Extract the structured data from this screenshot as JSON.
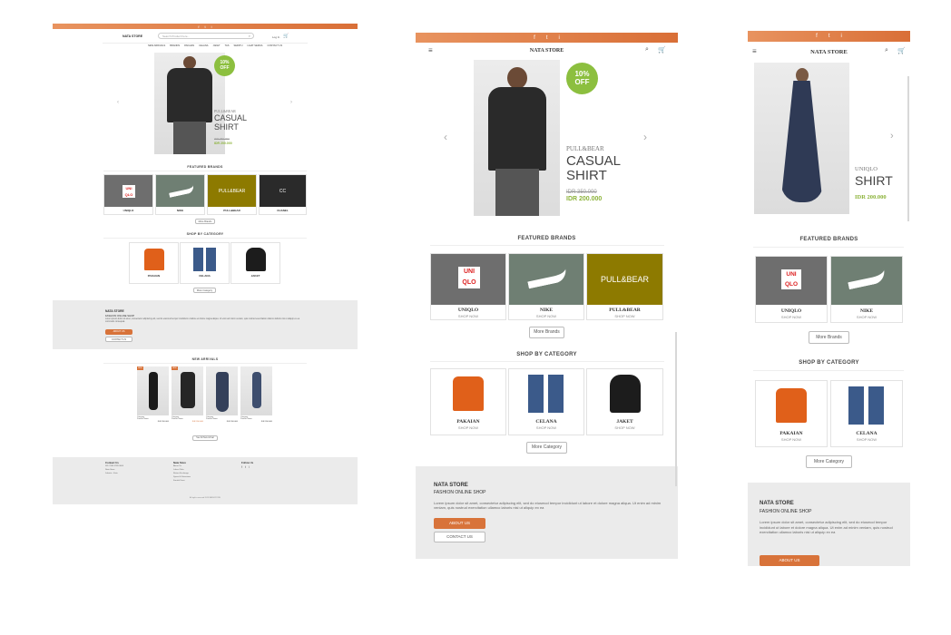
{
  "colors": {
    "accent": "#d8733a",
    "green": "#8cbf3f",
    "gray_section": "#ebebeb"
  },
  "brand": "NATA STORE",
  "social_icons": [
    "f",
    "t",
    "i"
  ],
  "desktop": {
    "search_placeholder": "Search Product here...",
    "login": "Log In",
    "nav": [
      "NEW ARRIVALS",
      "BRANDS",
      "PAKAIAN",
      "CELANA",
      "JAKET",
      "TAS",
      "SEPATU",
      "LIHAT SEMUA",
      "CONTACT US"
    ],
    "about_text": "Lorem ipsum dolor sit amet, consectetur adipiscing elit, sed do eiusmod tempor incididunt ut labore et dolore magna aliqua. Ut enim ad minim veniam, quis nostrud exercitation ullamco laboris nisi ut aliquip ex ea commodo consequat.",
    "new_arrivals_title": "NEW ARRIVALS",
    "new_arrival_names": [
      "Category\nProduct Name",
      "Category\nProduct Name",
      "Category\nProduct Name",
      "Category\nProduct Name"
    ],
    "new_arrival_prices": [
      "IDR 200.000",
      "IDR 200.000",
      "IDR 200.000",
      "IDR 200.000"
    ],
    "see_all": "See All New Arrival",
    "footer": {
      "contact_title": "Contact Us",
      "contact_lines": [
        "081 2345 6789 0000",
        "Nata Store",
        "Jakarta - Kota"
      ],
      "store_title": "Nata Store",
      "store_links": [
        "About Us",
        "Lokasi Toko",
        "Return Exchange",
        "Syarat & Ketentuan",
        "Kontak Kami"
      ],
      "follow_title": "Follow Us",
      "copyright": "All rights reserved 2019 NATA STORE"
    }
  },
  "hero": {
    "badge_pct": "10%",
    "badge_off": "OFF",
    "brand": "PULL&BEAR",
    "title_line1": "CASUAL",
    "title_line2": "SHIRT",
    "old_price": "IDR 350.000",
    "new_price": "IDR 200.000"
  },
  "hero2": {
    "brand": "UNIQLO",
    "title": "SHIRT",
    "price": "IDR 200.000"
  },
  "brands_title": "FEATURED BRANDS",
  "brands": [
    {
      "name": "UNIQLO",
      "sub": "SHOP NOW",
      "logo": "UNI\nQLO"
    },
    {
      "name": "NIKE",
      "sub": "SHOP NOW",
      "logo": ""
    },
    {
      "name": "PULL&BEAR",
      "sub": "SHOP NOW",
      "logo": "PULL&BEAR"
    },
    {
      "name": "CHANEL",
      "sub": "SHOP NOW",
      "logo": ""
    }
  ],
  "more_brands": "More Brands",
  "category_title": "SHOP BY CATEGORY",
  "categories": [
    {
      "name": "PAKAIAN",
      "sub": "SHOP NOW"
    },
    {
      "name": "CELANA",
      "sub": "SHOP NOW"
    },
    {
      "name": "JAKET",
      "sub": "SHOP NOW"
    }
  ],
  "more_category": "More Category",
  "about": {
    "title": "NATA STORE",
    "subtitle": "FASHION ONLINE SHOP",
    "text": "Lorem ipsum dolor sit amet, consectetur adipiscing elit, sed do eiusmod tempor incididunt ut labore et dolore magna aliqua. Ut enim ad minim veniam, quis nostrud exercitation ullamco laboris nisi ut aliquip ex ea",
    "about_btn": "ABOUT US",
    "contact_btn": "CONTACT US"
  }
}
